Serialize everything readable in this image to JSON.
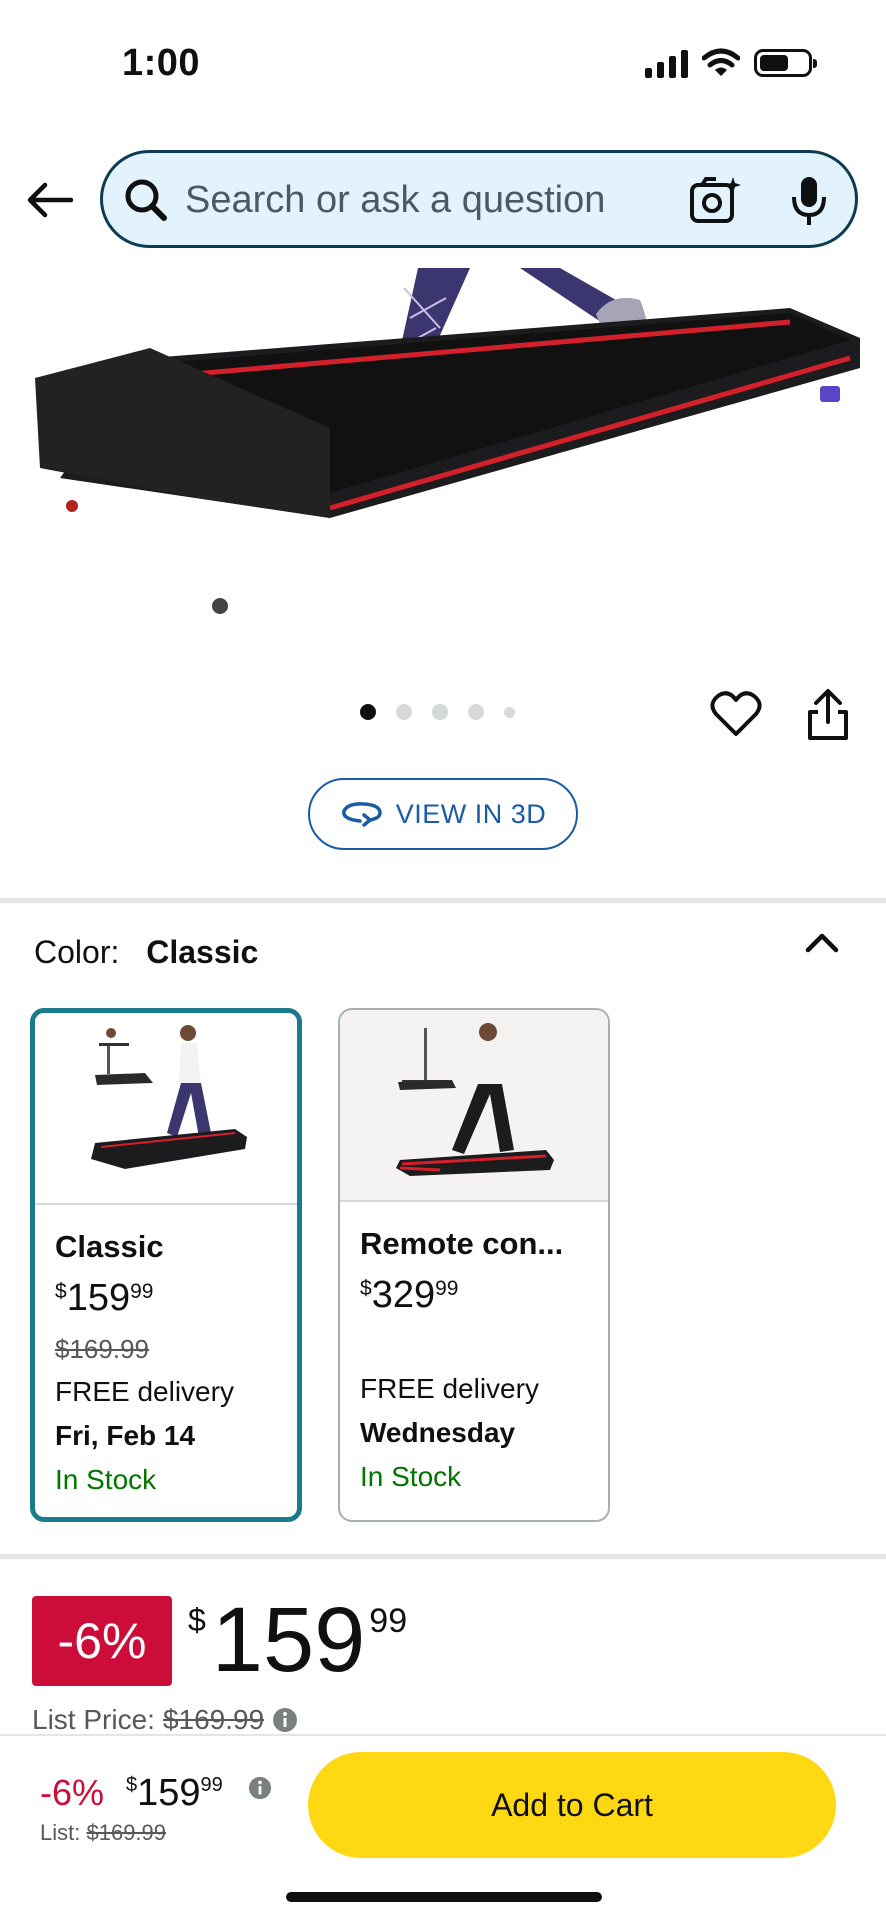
{
  "status_bar": {
    "time": "1:00",
    "icons": [
      "cellular-signal-icon",
      "wifi-icon",
      "battery-icon"
    ]
  },
  "search": {
    "placeholder": "Search or ask a question",
    "icons": [
      "back-arrow-icon",
      "search-icon",
      "camera-search-icon",
      "microphone-icon"
    ]
  },
  "gallery": {
    "image_count": 5,
    "active_index": 0,
    "actions": [
      "heart-icon",
      "share-icon"
    ],
    "view_3d_label": "VIEW IN 3D"
  },
  "color": {
    "label": "Color:",
    "selected": "Classic",
    "options": [
      {
        "name": "Classic",
        "price_symbol": "$",
        "price_whole": "159",
        "price_cents": "99",
        "list_price": "$169.99",
        "delivery": "FREE delivery",
        "delivery_date": "Fri, Feb 14",
        "stock": "In Stock"
      },
      {
        "name": "Remote con...",
        "price_symbol": "$",
        "price_whole": "329",
        "price_cents": "99",
        "list_price": "",
        "delivery": "FREE delivery",
        "delivery_date": "Wednesday",
        "stock": "In Stock"
      }
    ]
  },
  "price": {
    "discount": "-6%",
    "symbol": "$",
    "whole": "159",
    "cents": "99",
    "list_label": "List Price:",
    "list_value": "$169.99"
  },
  "buy_bar": {
    "discount": "-6%",
    "symbol": "$",
    "whole": "159",
    "cents": "99",
    "list_label": "List:",
    "list_value": "$169.99",
    "add_to_cart": "Add to Cart"
  },
  "colors": {
    "accent_teal": "#1a7b8c",
    "link_blue": "#1a5ba8",
    "deal_red": "#cc0c39",
    "stock_green": "#007600",
    "cart_yellow": "#ffd814",
    "search_bg": "#e3f3fd"
  }
}
